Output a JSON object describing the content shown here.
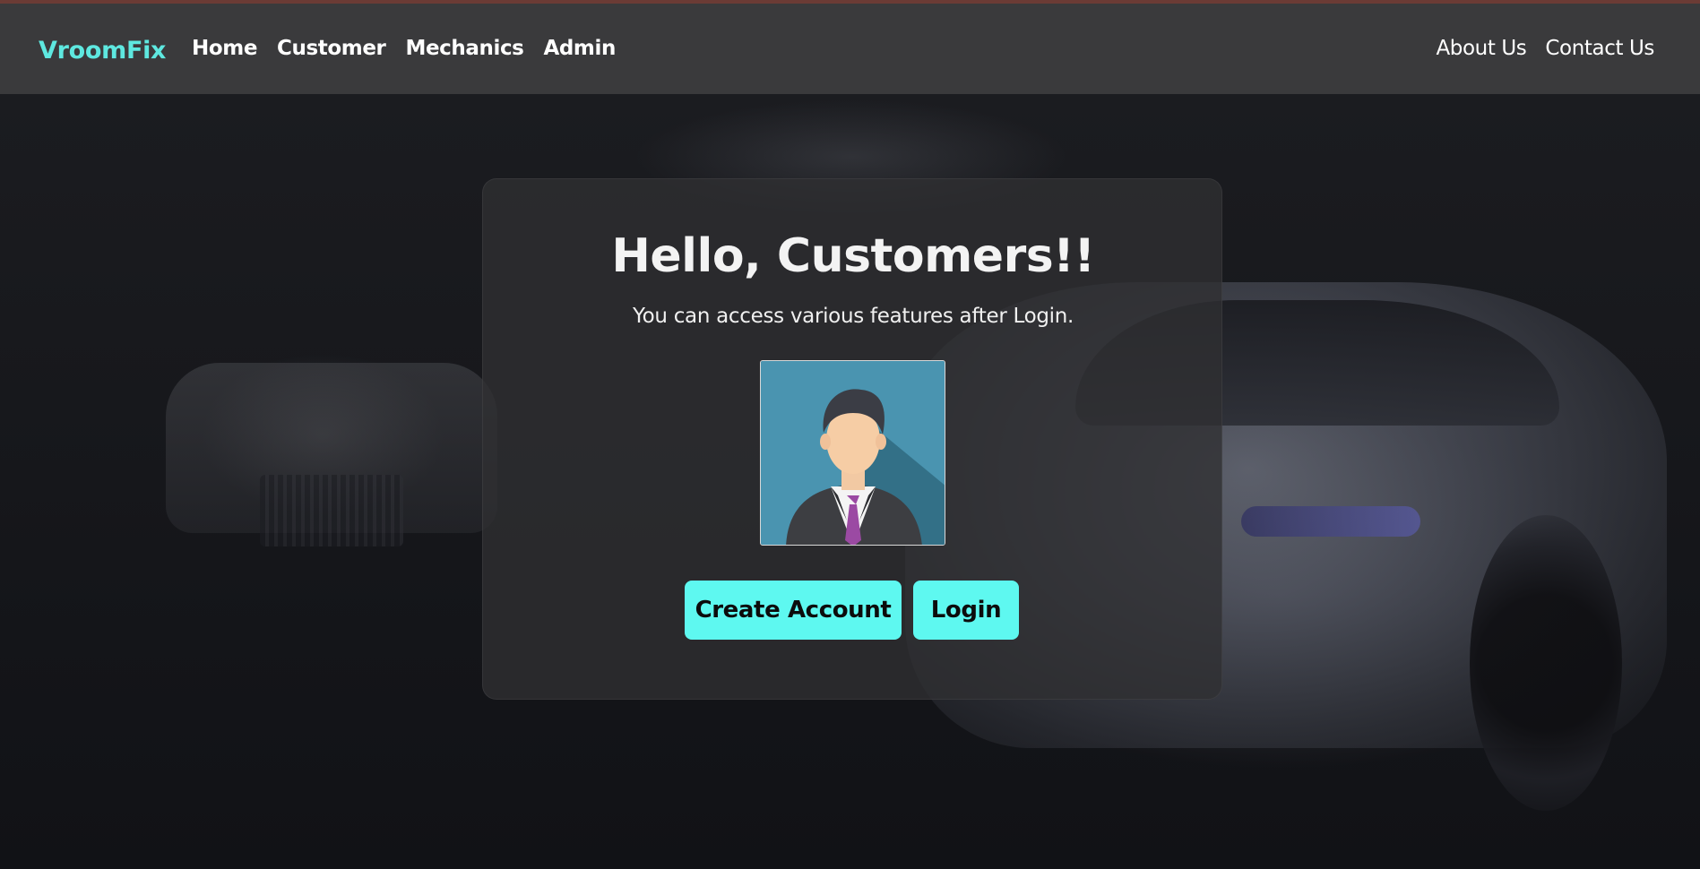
{
  "navbar": {
    "brand": "VroomFix",
    "left_links": [
      "Home",
      "Customer",
      "Mechanics",
      "Admin"
    ],
    "right_links": [
      "About Us",
      "Contact Us"
    ]
  },
  "card": {
    "title": "Hello, Customers!!",
    "subtitle": "You can access various features after Login.",
    "avatar_icon": "businessman-avatar-icon",
    "buttons": {
      "create_account": "Create Account",
      "login": "Login"
    }
  },
  "colors": {
    "accent": "#5ef8f0",
    "brand": "#5ee8e0",
    "navbar_bg": "#3a3a3c"
  }
}
